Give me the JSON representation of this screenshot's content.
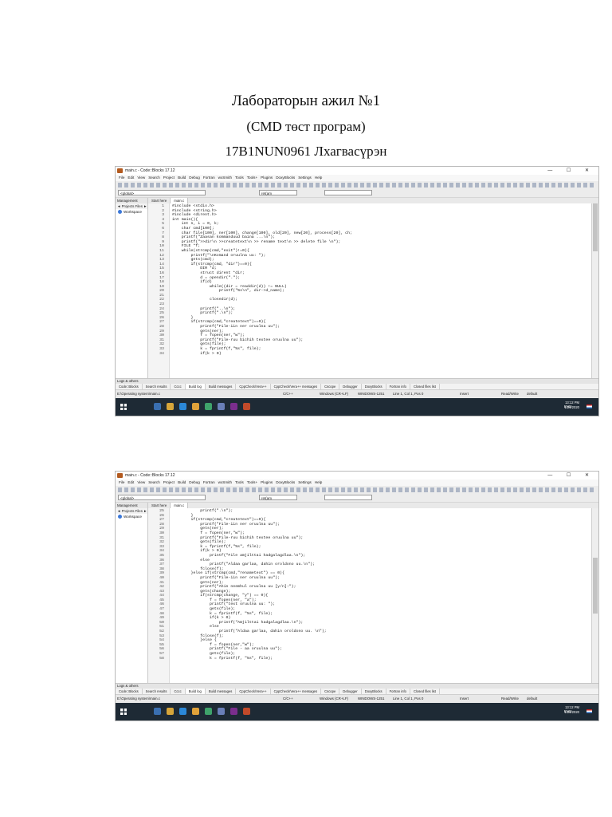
{
  "document": {
    "title": "Лабораторын ажил №1",
    "subtitle": "(CMD төст програм)",
    "author": "17B1NUN0961 Лхагвасүрэн"
  },
  "ide": {
    "window_title": "main.c - Code::Blocks 17.12",
    "window_controls": "— ☐ ✕",
    "menu": [
      "File",
      "Edit",
      "View",
      "Search",
      "Project",
      "Build",
      "Debug",
      "Fortran",
      "wxSmith",
      "Tools",
      "Tools+",
      "Plugins",
      "DoxyBlocks",
      "Settings",
      "Help"
    ],
    "scope_combo": "<global>",
    "search_combo": "ret(am",
    "management_label": "Management",
    "management_tabs": "◄ Projects  Files ►",
    "workspace_label": "Workspace",
    "editor_tabs": [
      "Start here",
      "main.c"
    ],
    "logs_label": "Logs & others",
    "log_tabs": [
      "Code::Blocks",
      "Search results",
      "Cccc",
      "Build log",
      "Build messages",
      "CppCheck/Vera++",
      "CppCheck/Vera++ messages",
      "Cscope",
      "Debugger",
      "DoxyBlocks",
      "Fortran info",
      "Closed files list"
    ],
    "status": {
      "path": "E:\\Operating system\\main.c",
      "lang": "C/C++",
      "eol": "Windows (CR+LF)",
      "encoding": "WINDOWS-1251",
      "position": "Line 1, Col 1, Pos 0",
      "mode": "Insert",
      "access": "Read/Write",
      "profile": "default"
    },
    "taskbar": {
      "lang": "ENG",
      "time": "13:12 PM",
      "date": "1/24/2020"
    }
  },
  "screenshot1": {
    "code": [
      {
        "n": "1",
        "t": "#include <stdio.h>"
      },
      {
        "n": "2",
        "t": "#include <string.h>"
      },
      {
        "n": "3",
        "t": "#include <dirent.h>"
      },
      {
        "n": "4",
        "t": "int main(){"
      },
      {
        "n": "5",
        "t": "    int n, i = 0, k;"
      },
      {
        "n": "6",
        "t": "    char cmd[100];"
      },
      {
        "n": "7",
        "t": "    char file[100], ner[100], change[100], old[20], new[20], process[20], ch;"
      },
      {
        "n": "8",
        "t": "    printf(\"Zaasan kommanduud baina ...\\n\");"
      },
      {
        "n": "9",
        "t": "    printf(\">>dir\\n >>createtext\\n >> rename text\\n >> delete file \\n\");"
      },
      {
        "n": "10",
        "t": "    FILE *f;"
      },
      {
        "n": "11",
        "t": "    while(strcmp(cmd,\"exit\")!=0){"
      },
      {
        "n": "12",
        "t": "        printf(\"\\nKomand oruulna uu: \");"
      },
      {
        "n": "13",
        "t": "        gets(cmd);"
      },
      {
        "n": "14",
        "t": "        if(strcmp(cmd, \"dir\")==0){"
      },
      {
        "n": "15",
        "t": "            DIR *d;"
      },
      {
        "n": "16",
        "t": "            struct dirent *dir;"
      },
      {
        "n": "17",
        "t": "            d = opendir(\".\");"
      },
      {
        "n": "18",
        "t": "            if(d)"
      },
      {
        "n": "19",
        "t": "                while((dir = readdir(d)) != NULL)"
      },
      {
        "n": "20",
        "t": "                    printf(\"%s\\n\", dir->d_name);"
      },
      {
        "n": "21",
        "t": ""
      },
      {
        "n": "22",
        "t": "                closedir(d);"
      },
      {
        "n": "23",
        "t": ""
      },
      {
        "n": "24",
        "t": "            printf(\"..\\n\");"
      },
      {
        "n": "25",
        "t": "            printf(\".\\n\");"
      },
      {
        "n": "26",
        "t": "        }"
      },
      {
        "n": "27",
        "t": "        if(strcmp(cmd,\"createtext\")==0){"
      },
      {
        "n": "28",
        "t": "            printf(\"File-iin ner oruulna uu\");"
      },
      {
        "n": "29",
        "t": "            gets(ner);"
      },
      {
        "n": "30",
        "t": "            f = fopen(ner,\"w\");"
      },
      {
        "n": "31",
        "t": "            printf(\"File-ruu bichih textee oruulna uu\");"
      },
      {
        "n": "32",
        "t": "            gets(file);"
      },
      {
        "n": "33",
        "t": "            k = fprintf(f,\"%s\", file);"
      },
      {
        "n": "34",
        "t": "            if(k > 0)"
      }
    ]
  },
  "screenshot2": {
    "code": [
      {
        "n": "25",
        "t": "            printf(\".\\n\");"
      },
      {
        "n": "26",
        "t": "        }"
      },
      {
        "n": "27",
        "t": "        if(strcmp(cmd,\"createtext\")==0){"
      },
      {
        "n": "28",
        "t": "            printf(\"File-iin ner oruulna uu\");"
      },
      {
        "n": "29",
        "t": "            gets(ner);"
      },
      {
        "n": "30",
        "t": "            f = fopen(ner,\"w\");"
      },
      {
        "n": "31",
        "t": "            printf(\"File-ruu bichih textee oruulna uu\");"
      },
      {
        "n": "32",
        "t": "            gets(file);"
      },
      {
        "n": "33",
        "t": "            k = fprintf(f,\"%s\", file);"
      },
      {
        "n": "34",
        "t": "            if(k > 0)"
      },
      {
        "n": "35",
        "t": "                printf(\"File amjilttai hadgalagdlaa.\\n\");"
      },
      {
        "n": "36",
        "t": "            else"
      },
      {
        "n": "37",
        "t": "                printf(\"Aldaa garlaa, dahin oroldono uu.\\n\");"
      },
      {
        "n": "38",
        "t": "            fclose(f);"
      },
      {
        "n": "39",
        "t": "        }else if(strcmp(cmd,\"renametext\") == 0){"
      },
      {
        "n": "40",
        "t": "            printf(\"File-iin ner oruulna uu\");"
      },
      {
        "n": "41",
        "t": "            gets(ner);"
      },
      {
        "n": "42",
        "t": "            printf(\"Ahin neemhul oruulna uu [y/n]:\");"
      },
      {
        "n": "43",
        "t": "            gets(change);"
      },
      {
        "n": "44",
        "t": "            if(strcmp(change, \"y\") == 0){"
      },
      {
        "n": "45",
        "t": "                f = fopen(ner, \"a\");"
      },
      {
        "n": "46",
        "t": "                printf(\"text oruulna uu: \");"
      },
      {
        "n": "47",
        "t": "                gets(file);"
      },
      {
        "n": "48",
        "t": "                k = fprintf(f, \"%s\", file);"
      },
      {
        "n": "49",
        "t": "                if(k > 0)"
      },
      {
        "n": "50",
        "t": "                    printf(\"Amjilttai hadgalagdlaa.\\n\");"
      },
      {
        "n": "51",
        "t": "                else"
      },
      {
        "n": "52",
        "t": "                    printf(\"Aldaa garlaa, dahin oroldono uu. \\n\");"
      },
      {
        "n": "53",
        "t": "            fclose(f);"
      },
      {
        "n": "54",
        "t": "            }else {"
      },
      {
        "n": "55",
        "t": "                f = fopen(ner,\"w\");"
      },
      {
        "n": "56",
        "t": "                printf(\"File - aa oruulna uu\");"
      },
      {
        "n": "57",
        "t": "                gets(file);"
      },
      {
        "n": "58",
        "t": "                k = fprintf(f, \"%s\", file);"
      }
    ]
  }
}
